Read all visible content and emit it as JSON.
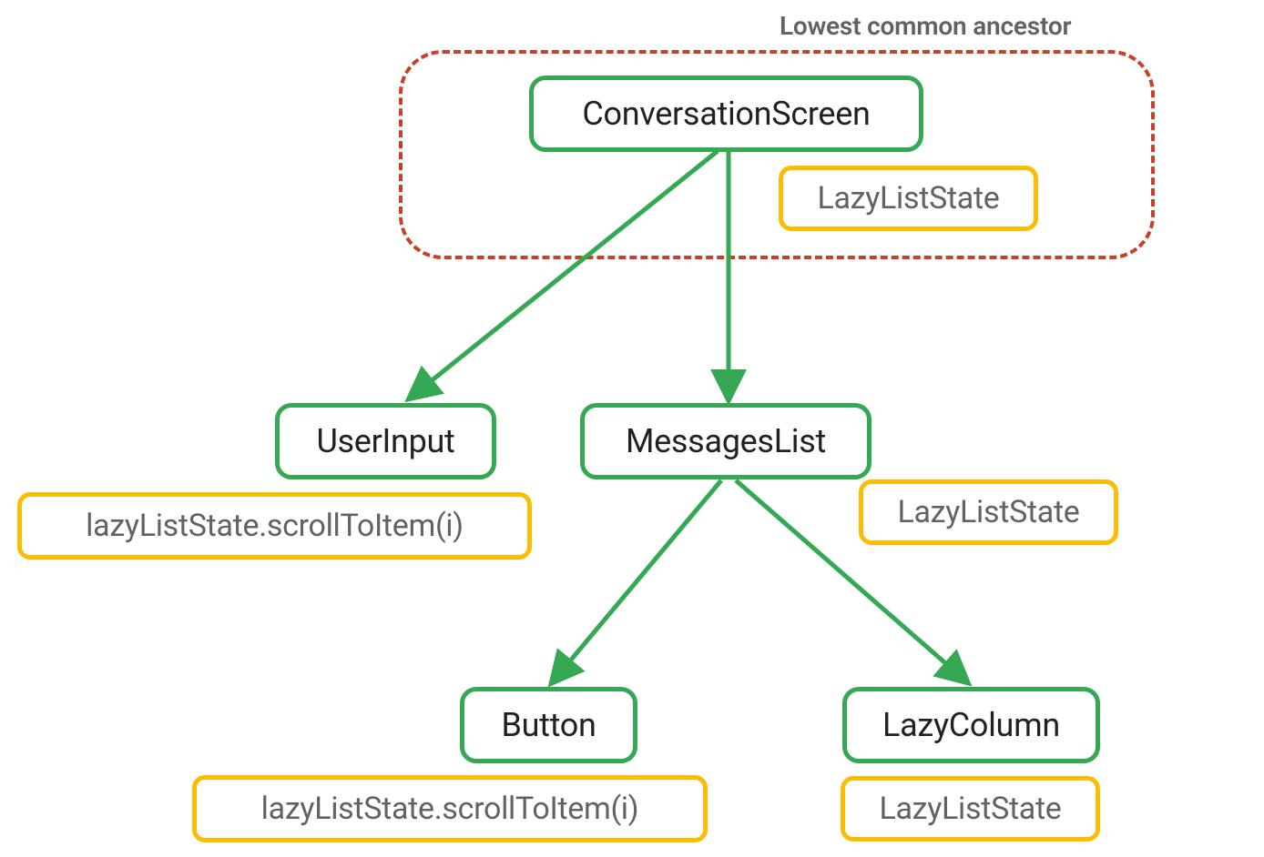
{
  "diagram": {
    "lca_label": "Lowest common ancestor",
    "nodes": {
      "conversation_screen": "ConversationScreen",
      "user_input": "UserInput",
      "messages_list": "MessagesList",
      "button": "Button",
      "lazy_column": "LazyColumn"
    },
    "annotations": {
      "conv_state": "LazyListState",
      "user_input_action": "lazyListState.scrollToItem(i)",
      "messages_list_state": "LazyListState",
      "button_action": "lazyListState.scrollToItem(i)",
      "lazy_column_state": "LazyListState"
    },
    "colors": {
      "node_border": "#34a853",
      "annotation_border": "#fbbc04",
      "lca_border": "#c5412a",
      "text_primary": "#202124",
      "text_secondary": "#5f6368"
    }
  }
}
